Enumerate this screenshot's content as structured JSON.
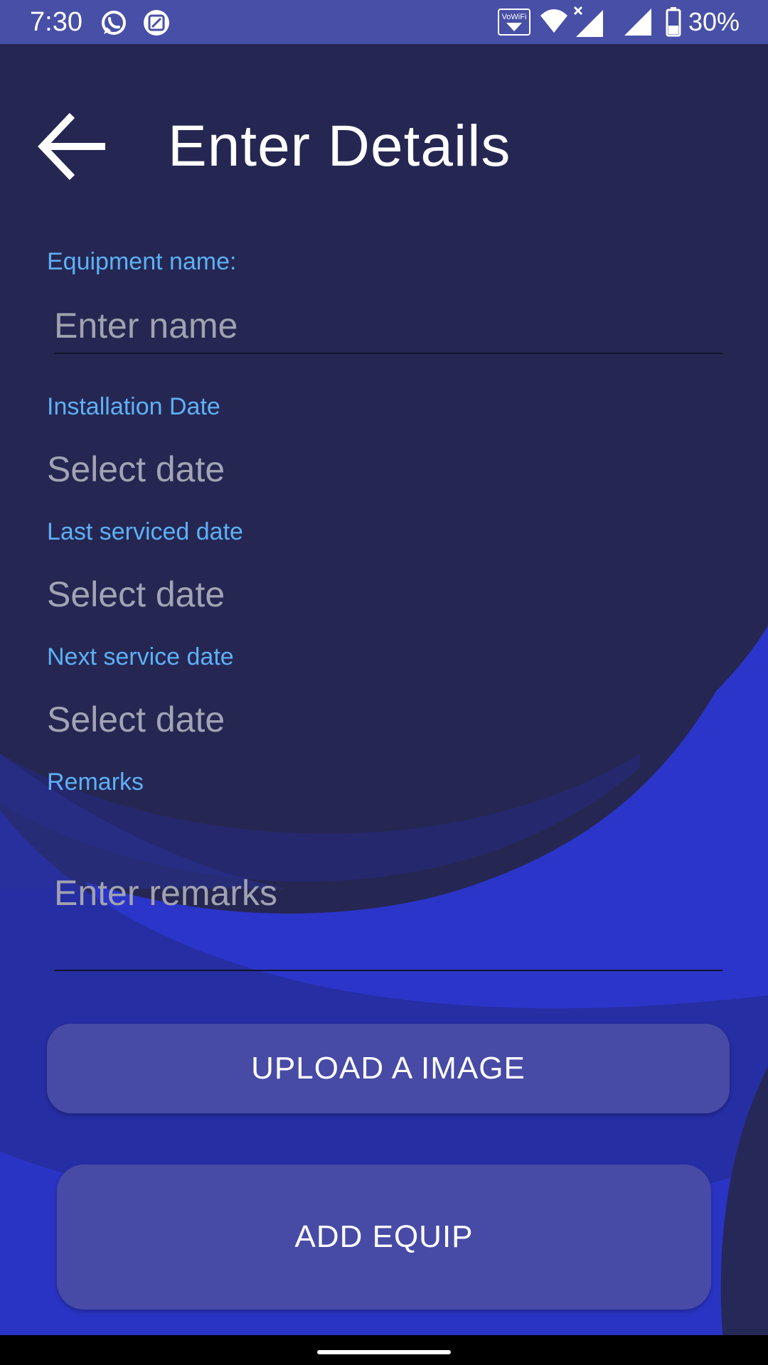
{
  "status_bar": {
    "time": "7:30",
    "battery_percent": "30%",
    "icons": [
      "whatsapp-icon",
      "screenshot-icon",
      "vowifi-icon",
      "wifi-icon",
      "cellular-no-data-icon",
      "cellular-icon",
      "battery-icon"
    ],
    "vowifi_label": "VoWiFi"
  },
  "header": {
    "title": "Enter Details",
    "back_icon": "arrow-back-icon"
  },
  "form": {
    "equipment_name_label": "Equipment name:",
    "equipment_name_placeholder": "Enter name",
    "installation_date_label": "Installation Date",
    "installation_date_value": "Select date",
    "last_serviced_label": "Last serviced date",
    "last_serviced_value": "Select date",
    "next_service_label": "Next service date",
    "next_service_value": "Select date",
    "remarks_label": "Remarks",
    "remarks_placeholder": "Enter remarks"
  },
  "actions": {
    "upload_label": "UPLOAD A IMAGE",
    "add_label": "ADD EQUIP"
  },
  "colors": {
    "background": "#252752",
    "status_bar": "#474fa6",
    "accent_label": "#5db0f6",
    "button": "#474ba6",
    "wave_bright": "#2b35c9",
    "wave_mid": "#252c9e"
  }
}
